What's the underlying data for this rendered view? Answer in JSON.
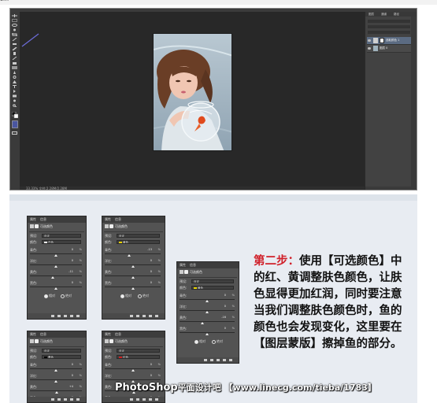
{
  "top_strip": {
    "text": "com"
  },
  "photoshop": {
    "status_text": "33.33% 文档:2.28M/2.28M",
    "tools": [
      "move",
      "marquee",
      "lasso",
      "quick-select",
      "crop",
      "eyedropper",
      "healing",
      "brush",
      "stamp",
      "history",
      "eraser",
      "gradient",
      "blur",
      "dodge",
      "pen",
      "type",
      "path-select",
      "shape",
      "hand",
      "zoom",
      "fg-bg"
    ],
    "layers_tabs": [
      "图层",
      "通道",
      "路径"
    ],
    "layers": [
      {
        "name": "选取颜色 1",
        "selected": true,
        "has_mask": true
      },
      {
        "name": "图层 0",
        "selected": false,
        "has_mask": false
      }
    ]
  },
  "panels": [
    {
      "tabs": [
        "属性",
        "信息"
      ],
      "title": "可选颜色",
      "preset_label": "预设:",
      "preset": "自定",
      "color_label": "颜色:",
      "color_name": "白色",
      "swatch": "#ffffff",
      "rows": [
        {
          "label": "青色:",
          "value": "0"
        },
        {
          "label": "洋红:",
          "value": "0"
        },
        {
          "label": "黄色:",
          "value": "-11"
        },
        {
          "label": "黑色:",
          "value": "0"
        }
      ],
      "relative": "相对",
      "absolute": "绝对"
    },
    {
      "tabs": [
        "属性",
        "信息"
      ],
      "title": "可选颜色",
      "preset_label": "预设:",
      "preset": "自定",
      "color_label": "颜色:",
      "color_name": "黄色",
      "swatch": "#e8d400",
      "rows": [
        {
          "label": "青色:",
          "value": "-13"
        },
        {
          "label": "洋红:",
          "value": "0"
        },
        {
          "label": "黄色:",
          "value": "0"
        },
        {
          "label": "黑色:",
          "value": "0"
        }
      ],
      "relative": "相对",
      "absolute": "绝对"
    },
    {
      "tabs": [
        "属性",
        "信息"
      ],
      "title": "可选颜色",
      "preset_label": "预设:",
      "preset": "自定",
      "color_label": "颜色:",
      "color_name": "黄色",
      "swatch": "#e8d400",
      "rows": [
        {
          "label": "青色:",
          "value": "0"
        },
        {
          "label": "洋红:",
          "value": "0"
        },
        {
          "label": "黄色:",
          "value": "-16"
        },
        {
          "label": "黑色:",
          "value": "0"
        }
      ],
      "relative": "相对",
      "absolute": "绝对"
    },
    {
      "tabs": [
        "属性",
        "信息"
      ],
      "title": "可选颜色",
      "preset_label": "预设:",
      "preset": "自定",
      "color_label": "颜色:",
      "color_name": "黑色",
      "swatch": "#000000",
      "rows": [
        {
          "label": "青色:",
          "value": "0"
        },
        {
          "label": "洋红:",
          "value": "0"
        },
        {
          "label": "黄色:",
          "value": "+4"
        },
        {
          "label": "黑色:",
          "value": "0"
        }
      ],
      "relative": "相对",
      "absolute": "绝对"
    },
    {
      "tabs": [
        "属性",
        "信息"
      ],
      "title": "可选颜色",
      "preset_label": "预设:",
      "preset": "自定",
      "color_label": "颜色:",
      "color_name": "红色",
      "swatch": "#d02020",
      "rows": [
        {
          "label": "青色:",
          "value": "0"
        },
        {
          "label": "洋红:",
          "value": "0"
        },
        {
          "label": "黄色:",
          "value": "+5"
        },
        {
          "label": "黑色:",
          "value": "0"
        }
      ],
      "relative": "相对",
      "absolute": "绝对"
    }
  ],
  "step_text": {
    "heading": "第二步：",
    "body": "使用【可选颜色】中的红、黄调整肤色颜色，让肤色显得更加红润，同时要注意当我们调整肤色颜色时，鱼的颜色也会发现变化，这里要在【图层蒙版】擦掉鱼的部分。"
  },
  "watermark": {
    "brand": "PhotoShop",
    "site": "平面设计吧",
    "url": "【www.linecg.com/tieba/1783】"
  },
  "colors": {
    "accent_red": "#d0202a",
    "ps_dark": "#282828",
    "panel_gray": "#535353",
    "page_bg": "#e8ecf2"
  }
}
